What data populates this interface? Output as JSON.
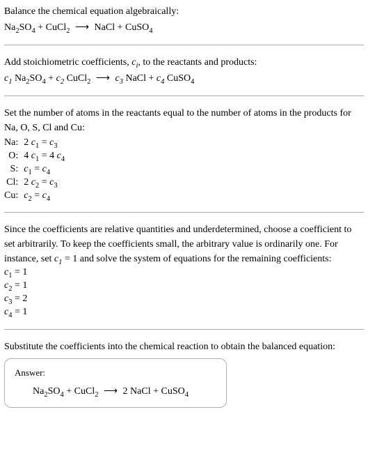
{
  "intro": {
    "line1": "Balance the chemical equation algebraically:"
  },
  "eq1": {
    "r1a": "Na",
    "r1a_sub": "2",
    "r1b": "SO",
    "r1b_sub": "4",
    "plus1": " + ",
    "r2a": "CuCl",
    "r2a_sub": "2",
    "arrow": "⟶",
    "p1": "NaCl",
    "plus2": " + ",
    "p2a": "CuSO",
    "p2a_sub": "4"
  },
  "stoich": {
    "line1a": "Add stoichiometric coefficients, ",
    "ci": "c",
    "ci_sub": "i",
    "line1b": ", to the reactants and products:"
  },
  "eq2": {
    "c1": "c",
    "c1_sub": "1",
    "sp1": " ",
    "r1a": "Na",
    "r1a_sub": "2",
    "r1b": "SO",
    "r1b_sub": "4",
    "plus1": " + ",
    "c2": "c",
    "c2_sub": "2",
    "sp2": " ",
    "r2a": "CuCl",
    "r2a_sub": "2",
    "arrow": "⟶",
    "c3": "c",
    "c3_sub": "3",
    "sp3": " ",
    "p1": "NaCl",
    "plus2": " + ",
    "c4": "c",
    "c4_sub": "4",
    "sp4": " ",
    "p2a": "CuSO",
    "p2a_sub": "4"
  },
  "atoms": {
    "line1": "Set the number of atoms in the reactants equal to the number of atoms in the products for Na, O, S, Cl and Cu:",
    "rows": [
      {
        "el": "Na:",
        "lhs_c": "2 ",
        "lhs_v": "c",
        "lhs_s": "1",
        "eq": " = ",
        "rhs_c": "",
        "rhs_v": "c",
        "rhs_s": "3"
      },
      {
        "el": "O:",
        "lhs_c": "4 ",
        "lhs_v": "c",
        "lhs_s": "1",
        "eq": " = ",
        "rhs_c": "4 ",
        "rhs_v": "c",
        "rhs_s": "4"
      },
      {
        "el": "S:",
        "lhs_c": "",
        "lhs_v": "c",
        "lhs_s": "1",
        "eq": " = ",
        "rhs_c": "",
        "rhs_v": "c",
        "rhs_s": "4"
      },
      {
        "el": "Cl:",
        "lhs_c": "2 ",
        "lhs_v": "c",
        "lhs_s": "2",
        "eq": " = ",
        "rhs_c": "",
        "rhs_v": "c",
        "rhs_s": "3"
      },
      {
        "el": "Cu:",
        "lhs_c": "",
        "lhs_v": "c",
        "lhs_s": "2",
        "eq": " = ",
        "rhs_c": "",
        "rhs_v": "c",
        "rhs_s": "4"
      }
    ]
  },
  "choose": {
    "text_a": "Since the coefficients are relative quantities and underdetermined, choose a coefficient to set arbitrarily. To keep the coefficients small, the arbitrary value is ordinarily one. For instance, set ",
    "cv": "c",
    "cv_sub": "1",
    "cv_eq": " = 1",
    "text_b": " and solve the system of equations for the remaining coefficients:",
    "coeffs": [
      {
        "v": "c",
        "s": "1",
        "eq": " = 1"
      },
      {
        "v": "c",
        "s": "2",
        "eq": " = 1"
      },
      {
        "v": "c",
        "s": "3",
        "eq": " = 2"
      },
      {
        "v": "c",
        "s": "4",
        "eq": " = 1"
      }
    ]
  },
  "substitute": {
    "text": "Substitute the coefficients into the chemical reaction to obtain the balanced equation:"
  },
  "answer": {
    "label": "Answer:",
    "r1a": "Na",
    "r1a_sub": "2",
    "r1b": "SO",
    "r1b_sub": "4",
    "plus1": " + ",
    "r2a": "CuCl",
    "r2a_sub": "2",
    "arrow": "⟶",
    "two": " 2 ",
    "p1": "NaCl",
    "plus2": " + ",
    "p2a": "CuSO",
    "p2a_sub": "4"
  }
}
